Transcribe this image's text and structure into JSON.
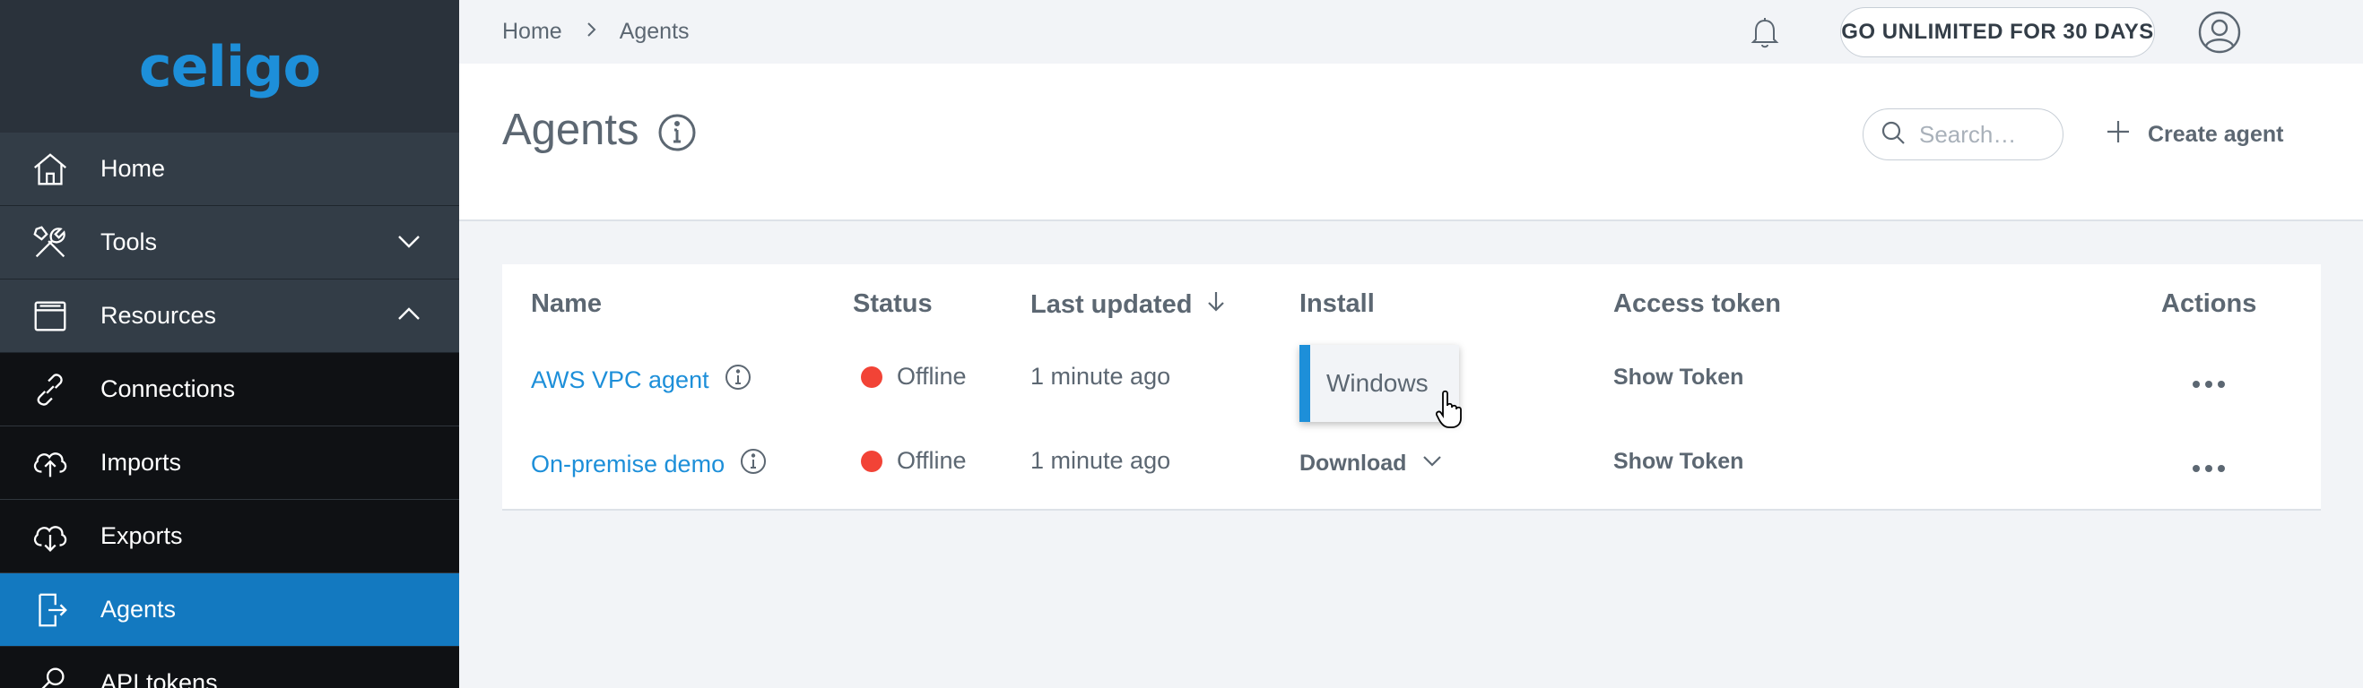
{
  "brand": {
    "logo_text": "celigo",
    "logo_color": "#1d8fd9"
  },
  "sidebar": {
    "items": [
      {
        "label": "Home",
        "icon": "home-icon"
      },
      {
        "label": "Tools",
        "icon": "tools-icon",
        "chevron": "chevron-down-icon"
      },
      {
        "label": "Resources",
        "icon": "resources-icon",
        "chevron": "chevron-up-icon"
      },
      {
        "label": "Connections",
        "icon": "connections-icon"
      },
      {
        "label": "Imports",
        "icon": "imports-icon"
      },
      {
        "label": "Exports",
        "icon": "exports-icon"
      },
      {
        "label": "Agents",
        "icon": "agents-icon",
        "active": true
      },
      {
        "label": "API tokens",
        "icon": "api-tokens-icon"
      }
    ],
    "active_color": "#1379c0"
  },
  "topbar": {
    "breadcrumb": [
      "Home",
      "Agents"
    ],
    "unlimited_label": "GO UNLIMITED FOR 30 DAYS"
  },
  "header": {
    "title": "Agents",
    "search_placeholder": "Search…",
    "create_label": "Create agent"
  },
  "table": {
    "columns": [
      "Name",
      "Status",
      "Last updated",
      "Install",
      "Access token",
      "Actions"
    ],
    "rows": [
      {
        "name": "AWS VPC agent",
        "status": "Offline",
        "last_updated": "1 minute ago",
        "install": "Windows",
        "token": "Show Token"
      },
      {
        "name": "On-premise demo",
        "status": "Offline",
        "last_updated": "1 minute ago",
        "install": "Download",
        "token": "Show Token"
      }
    ],
    "status_color": "#f24336"
  }
}
